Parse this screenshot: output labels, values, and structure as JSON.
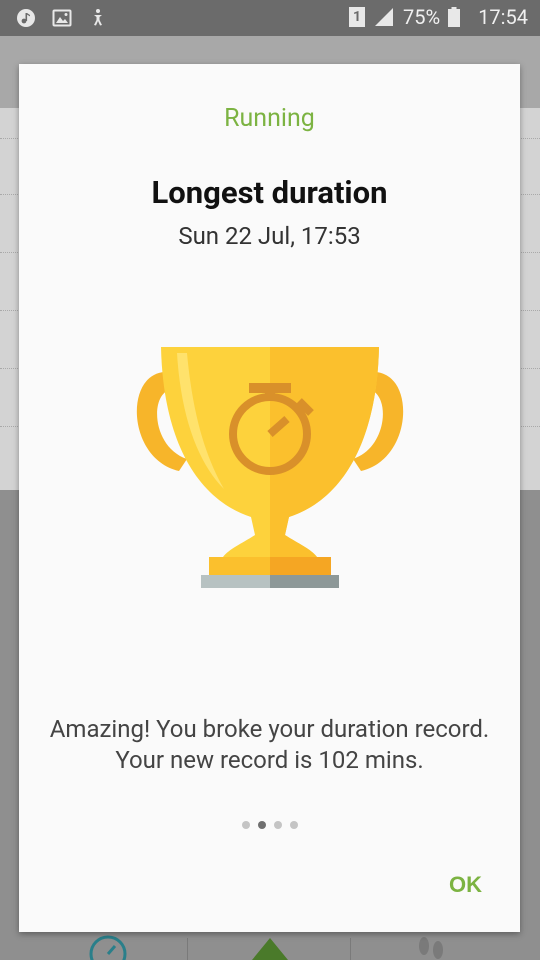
{
  "status_bar": {
    "left_icons": [
      "music-icon",
      "image-icon",
      "accessibility-icon"
    ],
    "sim_badge": "1",
    "battery_percent": "75%",
    "time": "17:54"
  },
  "dialog": {
    "category": "Running",
    "title": "Longest duration",
    "date": "Sun 22 Jul, 17:53",
    "message": "Amazing! You broke your duration record. Your new record is 102 mins.",
    "pager": {
      "total": 4,
      "active_index": 1
    },
    "ok_label": "OK"
  },
  "colors": {
    "accent_green": "#7cb342",
    "trophy_gold": "#fbc02d",
    "trophy_dark": "#f9a825",
    "stopwatch_brown": "#d9902a"
  }
}
